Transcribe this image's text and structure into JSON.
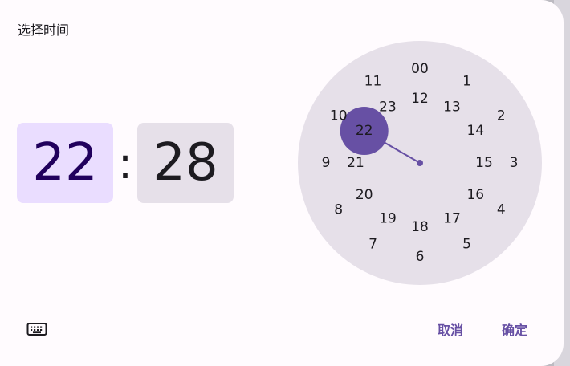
{
  "dialog": {
    "title": "选择时间"
  },
  "time": {
    "hour": "22",
    "separator": ":",
    "minute": "28"
  },
  "clock": {
    "selected_hour": "22",
    "outer_numbers": [
      "00",
      "1",
      "2",
      "3",
      "4",
      "5",
      "6",
      "7",
      "8",
      "9",
      "10",
      "11"
    ],
    "inner_numbers": [
      "12",
      "13",
      "14",
      "15",
      "16",
      "17",
      "18",
      "19",
      "20",
      "21",
      "22",
      "23"
    ]
  },
  "actions": {
    "keyboard_icon": "keyboard-icon",
    "cancel_label": "取消",
    "ok_label": "确定"
  },
  "colors": {
    "accent": "#6750a4",
    "hour_bg": "#eaddff",
    "minute_bg": "#e6e0e9",
    "dial_bg": "#e6e0e9"
  }
}
